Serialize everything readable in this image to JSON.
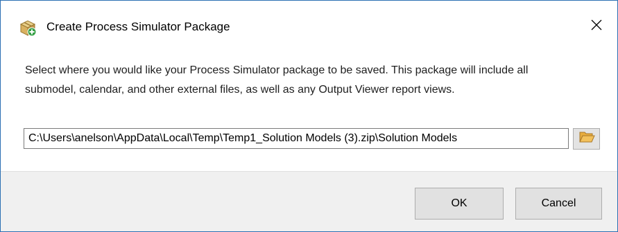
{
  "window": {
    "title": "Create Process Simulator Package",
    "icon": "package-add-icon",
    "close_icon": "close-icon"
  },
  "message": "Select where you would like your Process Simulator package to be saved. This package will include all submodel, calendar, and other external files, as well as any Output Viewer report views.",
  "path_field": {
    "value": "C:\\Users\\anelson\\AppData\\Local\\Temp\\Temp1_Solution Models (3).zip\\Solution Models"
  },
  "browse": {
    "icon": "folder-open-icon"
  },
  "buttons": {
    "ok_label": "OK",
    "cancel_label": "Cancel"
  },
  "colors": {
    "border": "#2b6fb3",
    "footer_background": "#f0f0f0",
    "folder": "#f2c15c"
  }
}
